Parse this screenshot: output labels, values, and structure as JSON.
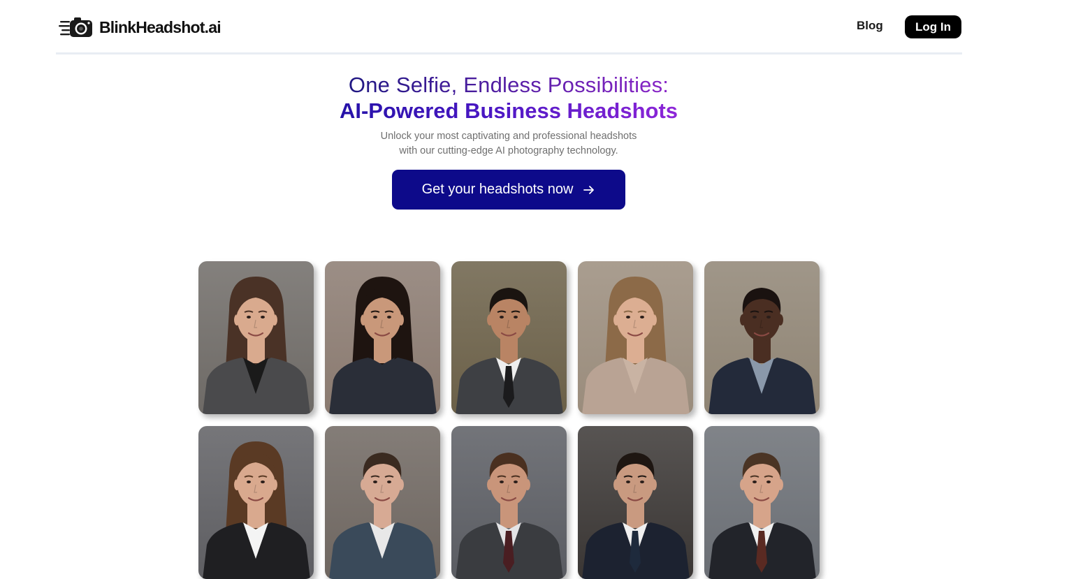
{
  "header": {
    "logo_text": "BlinkHeadshot.ai",
    "logo_icon": "camera-icon",
    "nav": {
      "blog_label": "Blog"
    },
    "login_label": "Log In"
  },
  "hero": {
    "line1": "One Selfie, Endless Possibilities:",
    "line2": "AI-Powered Business Headshots",
    "subtitle_line1": "Unlock your most captivating and professional headshots",
    "subtitle_line2": "with our cutting-edge AI photography technology.",
    "cta_label": "Get your headshots now",
    "cta_icon": "arrow-right-icon"
  },
  "colors": {
    "cta_bg": "#0d0a8a",
    "gradient_start": "#2512a8",
    "gradient_end": "#8e26d8",
    "login_bg": "#000000"
  },
  "gallery": {
    "headshots": [
      {
        "bg": "#6e6a66",
        "skin": "#d9aa8e",
        "hair": "#4a3226",
        "suit": "#4a4a4c",
        "shirt": "#1a1a1a",
        "tie": "",
        "hair_style": "long"
      },
      {
        "bg": "#8a7a70",
        "skin": "#c9987a",
        "hair": "#1e1410",
        "suit": "#2a2e38",
        "shirt": "#2a2e38",
        "tie": "",
        "hair_style": "long"
      },
      {
        "bg": "#6b6048",
        "skin": "#b98464",
        "hair": "#1a1410",
        "suit": "#3e4044",
        "shirt": "#eeeeee",
        "tie": "#1b1b1d",
        "hair_style": "short"
      },
      {
        "bg": "#9a8c7c",
        "skin": "#dcae92",
        "hair": "#8c6a48",
        "suit": "#b9a394",
        "shirt": "#c9b3a3",
        "tie": "",
        "hair_style": "long"
      },
      {
        "bg": "#8f8474",
        "skin": "#4a2e22",
        "hair": "#1a1210",
        "suit": "#232a3a",
        "shirt": "#8a98aa",
        "tie": "",
        "hair_style": "short"
      },
      {
        "bg": "#5e5e62",
        "skin": "#d9a98e",
        "hair": "#5a3a24",
        "suit": "#1f1f22",
        "shirt": "#f4f4f4",
        "tie": "",
        "hair_style": "long"
      },
      {
        "bg": "#6e6660",
        "skin": "#d7aa94",
        "hair": "#3a2a20",
        "suit": "#3a4a5a",
        "shirt": "#e8e8e8",
        "tie": "",
        "hair_style": "short"
      },
      {
        "bg": "#5a5c62",
        "skin": "#c9957a",
        "hair": "#4a3020",
        "suit": "#3a3c40",
        "shirt": "#e4e4e6",
        "tie": "#4a1e22",
        "hair_style": "short"
      },
      {
        "bg": "#3a3634",
        "skin": "#c99a80",
        "hair": "#1e1612",
        "suit": "#1c2230",
        "shirt": "#f0f0f0",
        "tie": "#1e2a3c",
        "hair_style": "short"
      },
      {
        "bg": "#6a6e74",
        "skin": "#d6a48a",
        "hair": "#4a3424",
        "suit": "#22242a",
        "shirt": "#f0f0f0",
        "tie": "#5a2a22",
        "hair_style": "short"
      }
    ]
  }
}
